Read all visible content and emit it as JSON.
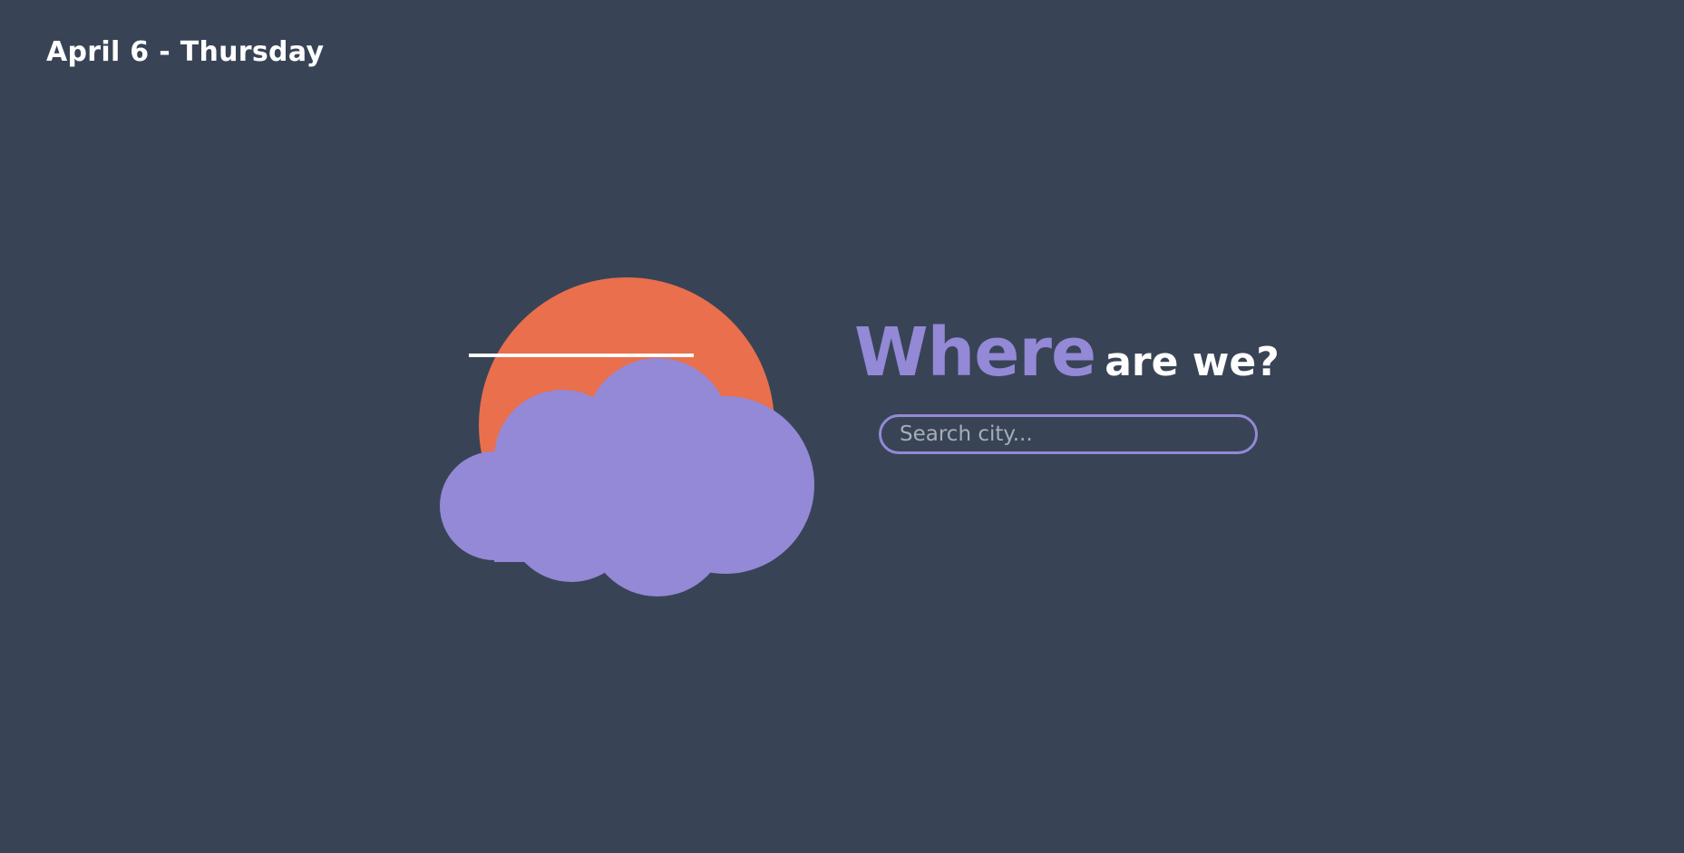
{
  "header": {
    "date": "April 6 - Thursday"
  },
  "illustration": {
    "sun_icon": "sun-icon",
    "cloud_icon": "cloud-icon",
    "sun_color": "#e96f4d",
    "cloud_color": "#9389d6",
    "line_color": "#ffffff"
  },
  "headline": {
    "accent": "Where",
    "rest": "are we?"
  },
  "search": {
    "placeholder": "Search city...",
    "value": ""
  },
  "colors": {
    "background": "#384456",
    "accent": "#9389d6",
    "text": "#ffffff"
  }
}
